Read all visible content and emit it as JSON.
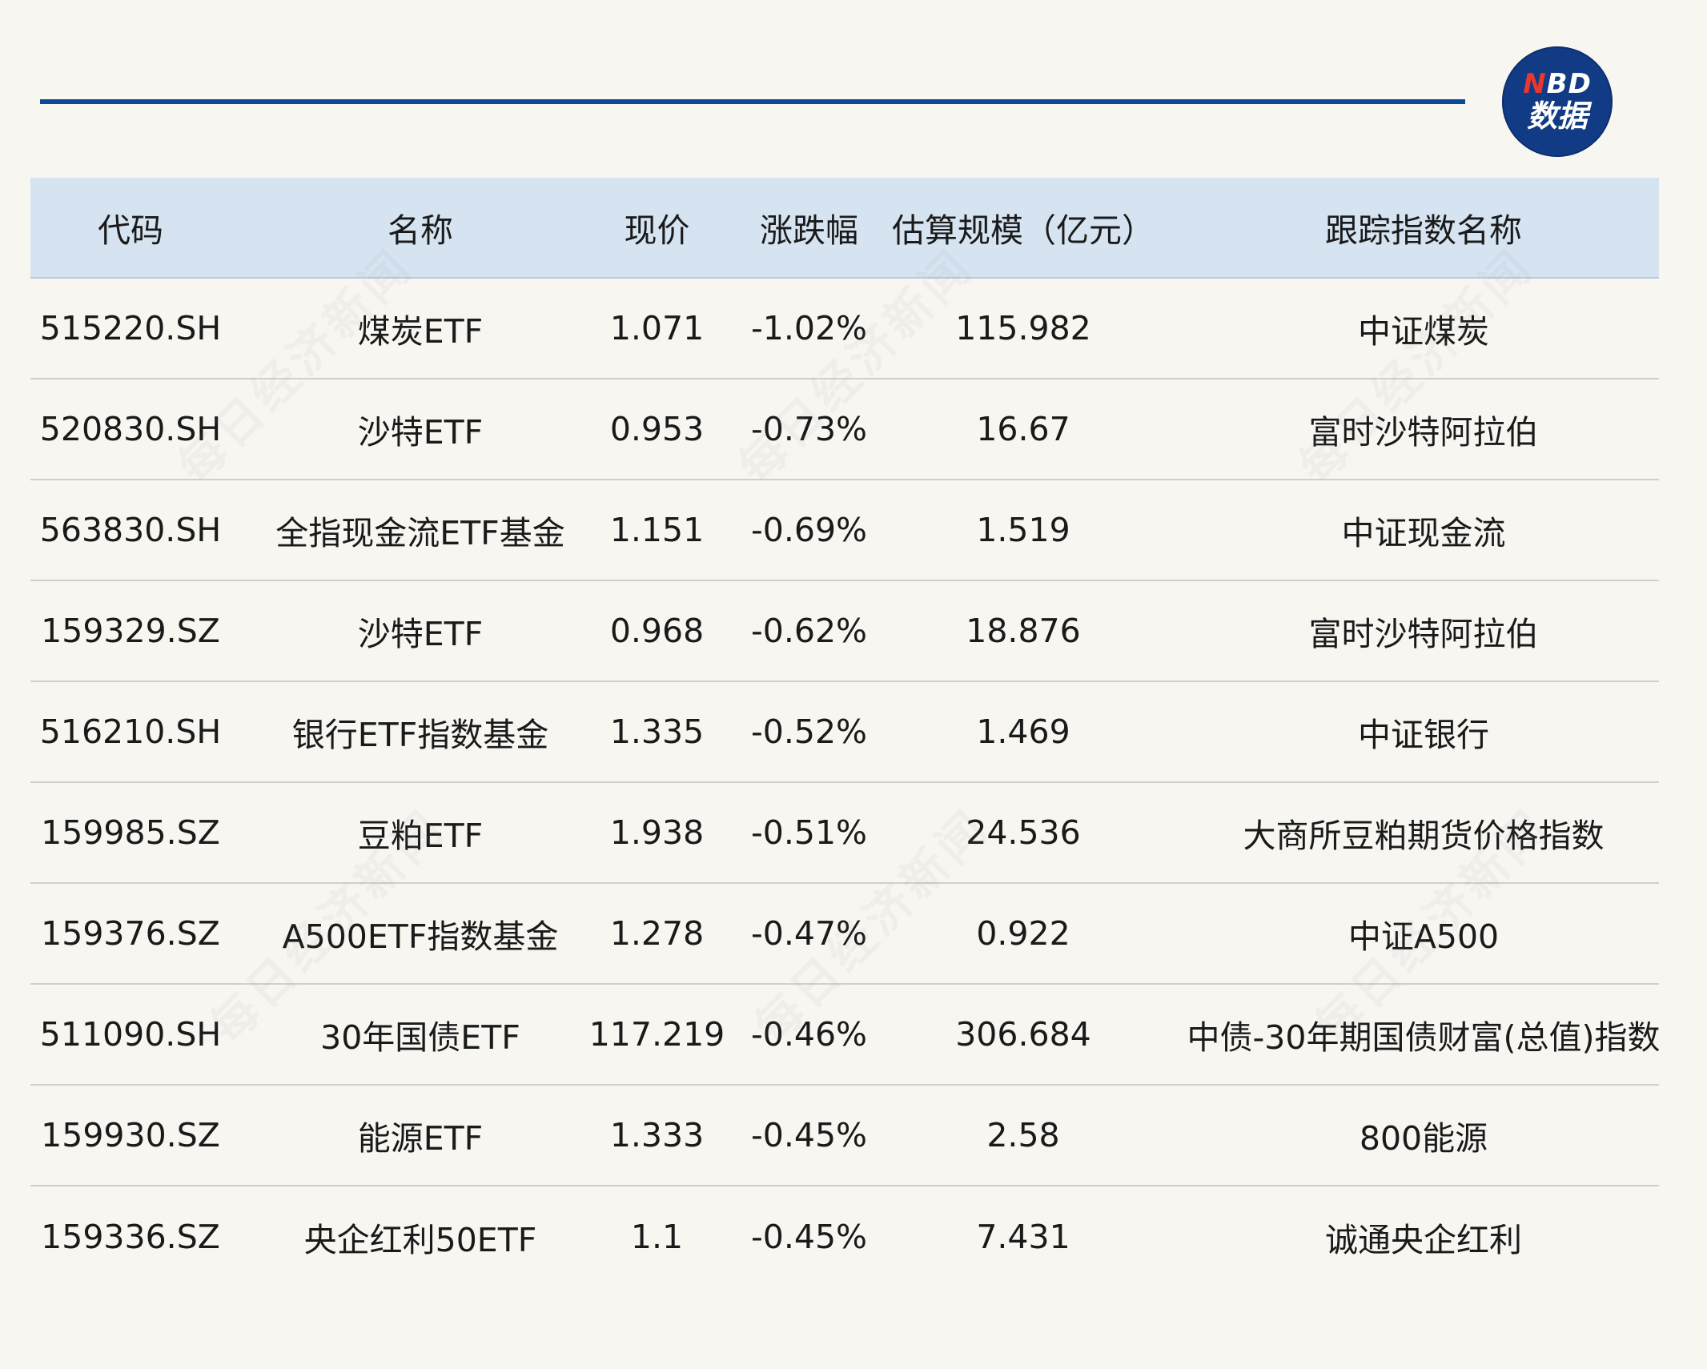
{
  "brand": {
    "logo_top_n": "N",
    "logo_top_rest": "BD",
    "logo_bottom": "数据",
    "rule_color": "#0d4a96",
    "logo_color": "#123b85",
    "logo_accent": "#e8382f"
  },
  "watermark_text": "每日经济新闻",
  "table": {
    "header_bg": "#d6e4f1",
    "columns": [
      "代码",
      "名称",
      "现价",
      "涨跌幅",
      "估算规模（亿元）",
      "跟踪指数名称"
    ],
    "rows": [
      [
        "515220.SH",
        "煤炭ETF",
        "1.071",
        "-1.02%",
        "115.982",
        "中证煤炭"
      ],
      [
        "520830.SH",
        "沙特ETF",
        "0.953",
        "-0.73%",
        "16.67",
        "富时沙特阿拉伯"
      ],
      [
        "563830.SH",
        "全指现金流ETF基金",
        "1.151",
        "-0.69%",
        "1.519",
        "中证现金流"
      ],
      [
        "159329.SZ",
        "沙特ETF",
        "0.968",
        "-0.62%",
        "18.876",
        "富时沙特阿拉伯"
      ],
      [
        "516210.SH",
        "银行ETF指数基金",
        "1.335",
        "-0.52%",
        "1.469",
        "中证银行"
      ],
      [
        "159985.SZ",
        "豆粕ETF",
        "1.938",
        "-0.51%",
        "24.536",
        "大商所豆粕期货价格指数"
      ],
      [
        "159376.SZ",
        "A500ETF指数基金",
        "1.278",
        "-0.47%",
        "0.922",
        "中证A500"
      ],
      [
        "511090.SH",
        "30年国债ETF",
        "117.219",
        "-0.46%",
        "306.684",
        "中债-30年期国债财富(总值)指数"
      ],
      [
        "159930.SZ",
        "能源ETF",
        "1.333",
        "-0.45%",
        "2.58",
        "800能源"
      ],
      [
        "159336.SZ",
        "央企红利50ETF",
        "1.1",
        "-0.45%",
        "7.431",
        "诚通央企红利"
      ]
    ]
  }
}
